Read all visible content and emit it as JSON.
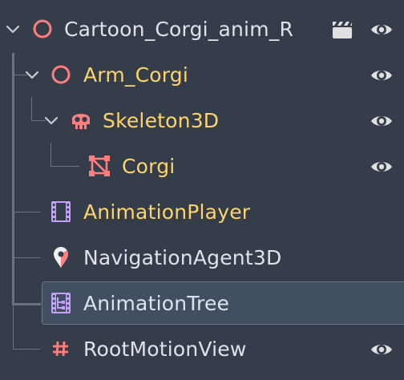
{
  "colors": {
    "background": "#363d4a",
    "selected_background": "#424f63",
    "name_modified": "#fcd46a",
    "name_default": "#dfe3e9",
    "node_icon_red": "#fc7f7f",
    "animation_icon_purple": "#c59ff9",
    "eye_icon": "#e0e0e0",
    "guide_line": "#6a7280"
  },
  "scene_tree": {
    "nodes": [
      {
        "name": "Cartoon_Corgi_anim_R",
        "icon": "node3d-circle-icon",
        "expanded": true,
        "extra_icon": "clapperboard-icon",
        "visibility_icon": "eye-icon"
      },
      {
        "name": "Arm_Corgi",
        "icon": "node3d-circle-icon",
        "expanded": true,
        "visibility_icon": "eye-icon"
      },
      {
        "name": "Skeleton3D",
        "icon": "skull-icon",
        "expanded": true,
        "visibility_icon": "eye-icon"
      },
      {
        "name": "Corgi",
        "icon": "mesh-instance-icon",
        "visibility_icon": "eye-icon"
      },
      {
        "name": "AnimationPlayer",
        "icon": "film-strip-icon"
      },
      {
        "name": "NavigationAgent3D",
        "icon": "map-pin-icon"
      },
      {
        "name": "AnimationTree",
        "icon": "animation-tree-icon",
        "selected": true
      },
      {
        "name": "RootMotionView",
        "icon": "hash-grid-icon",
        "visibility_icon": "eye-icon"
      }
    ]
  }
}
